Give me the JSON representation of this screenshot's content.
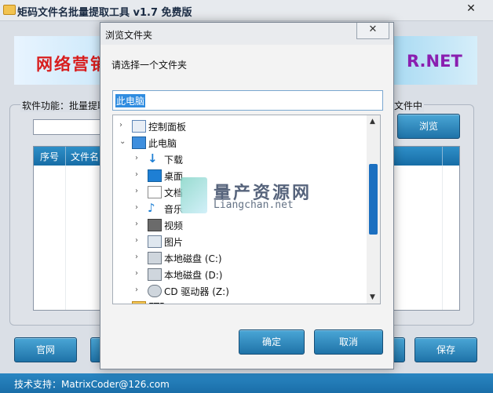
{
  "app": {
    "title": "矩码文件名批量提取工具 v1.7 免费版",
    "close": "✕"
  },
  "banner": {
    "left_text": "网络营销",
    "right_text": "R.NET"
  },
  "main": {
    "feature_label": "软件功能：批量提取",
    "feature_label_tail": "文件中",
    "browse_label": "浏览",
    "columns": [
      "序号",
      "文件名"
    ],
    "buttons": {
      "website": "官网",
      "save": "保存"
    },
    "status": "技术支持：MatrixCoder@126.com"
  },
  "dialog": {
    "title": "浏览文件夹",
    "close": "✕",
    "prompt": "请选择一个文件夹",
    "selected_path": "此电脑",
    "tree": [
      {
        "label": "控制面板",
        "icon": "control-panel-icon",
        "level": 0,
        "expander": "›"
      },
      {
        "label": "此电脑",
        "icon": "computer-icon",
        "level": 0,
        "expander": "⌄"
      },
      {
        "label": "下载",
        "icon": "download-icon",
        "level": 1,
        "expander": "›"
      },
      {
        "label": "桌面",
        "icon": "desktop-icon",
        "level": 1,
        "expander": "›"
      },
      {
        "label": "文档",
        "icon": "document-icon",
        "level": 1,
        "expander": "›"
      },
      {
        "label": "音乐",
        "icon": "music-icon",
        "level": 1,
        "expander": "›"
      },
      {
        "label": "视频",
        "icon": "video-icon",
        "level": 1,
        "expander": "›"
      },
      {
        "label": "图片",
        "icon": "pictures-icon",
        "level": 1,
        "expander": "›"
      },
      {
        "label": "本地磁盘 (C:)",
        "icon": "drive-c-icon",
        "level": 1,
        "expander": "›"
      },
      {
        "label": "本地磁盘 (D:)",
        "icon": "drive-d-icon",
        "level": 1,
        "expander": "›"
      },
      {
        "label": "CD 驱动器 (Z:)",
        "icon": "cd-drive-icon",
        "level": 1,
        "expander": "›"
      },
      {
        "label": "FTP",
        "icon": "folder-icon",
        "level": 0,
        "expander": ""
      }
    ],
    "buttons": {
      "ok": "确定",
      "cancel": "取消"
    }
  },
  "watermark": {
    "cn": "量产资源网",
    "en": "Liangchan.net"
  },
  "colors": {
    "accent": "#1f73a8",
    "selection": "#2f8ce0"
  }
}
